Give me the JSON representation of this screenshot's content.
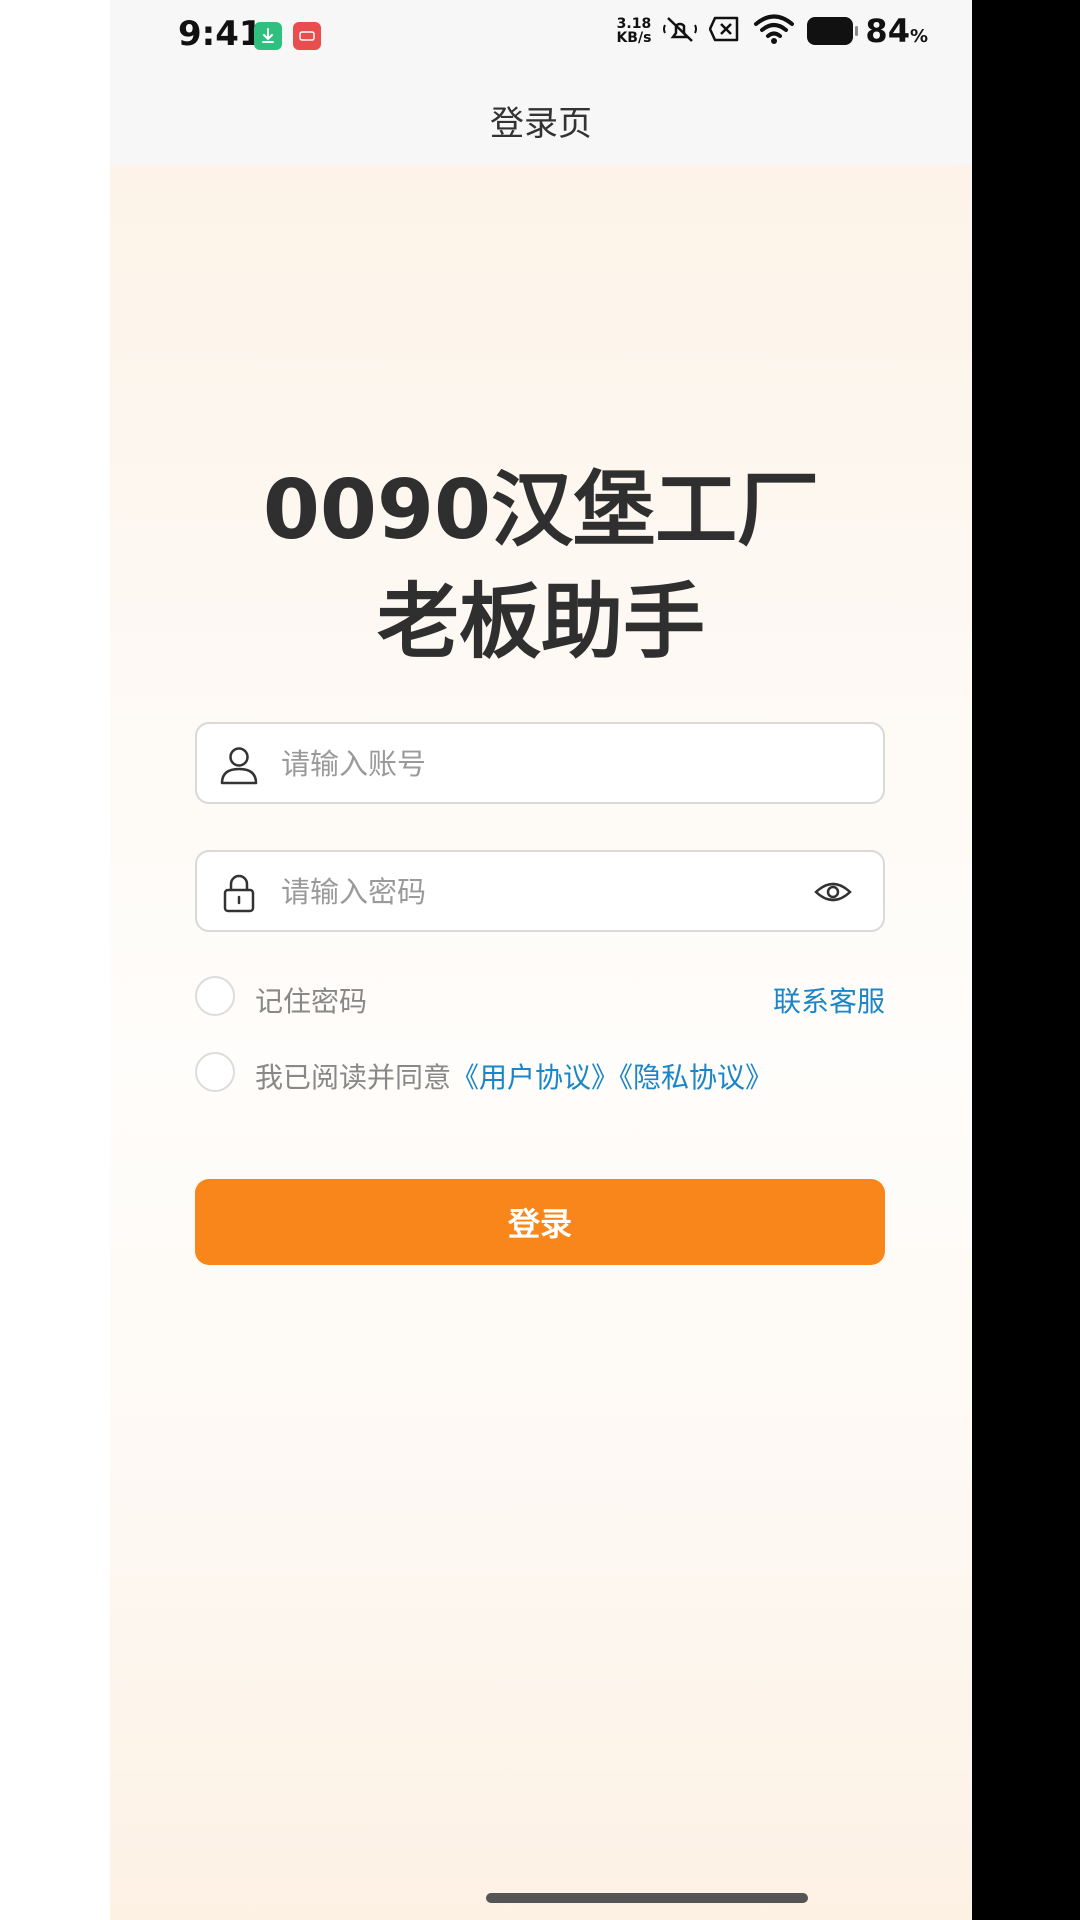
{
  "status_bar": {
    "time": "9:41",
    "net_speed_value": "3.18",
    "net_speed_unit": "KB/s",
    "battery_percent": "84",
    "battery_unit": "%",
    "icons": [
      "download-app-icon",
      "red-app-icon",
      "mute-icon",
      "sim-off-icon",
      "wifi-icon",
      "battery-icon"
    ]
  },
  "header": {
    "title": "登录页"
  },
  "hero": {
    "line1": "0090汉堡工厂",
    "line2": "老板助手"
  },
  "form": {
    "account_placeholder": "请输入账号",
    "account_value": "",
    "password_placeholder": "请输入密码",
    "password_value": "",
    "remember_label": "记住密码",
    "remember_checked": false,
    "contact_label": "联系客服",
    "agree_prefix": "我已阅读并同意",
    "user_agreement": "《用户协议》",
    "privacy_agreement": "《隐私协议》",
    "agree_checked": false,
    "login_label": "登录"
  },
  "colors": {
    "accent": "#f8861a",
    "link": "#1a86c8",
    "app_green": "#2fbf7f",
    "app_red": "#e94d4d"
  }
}
